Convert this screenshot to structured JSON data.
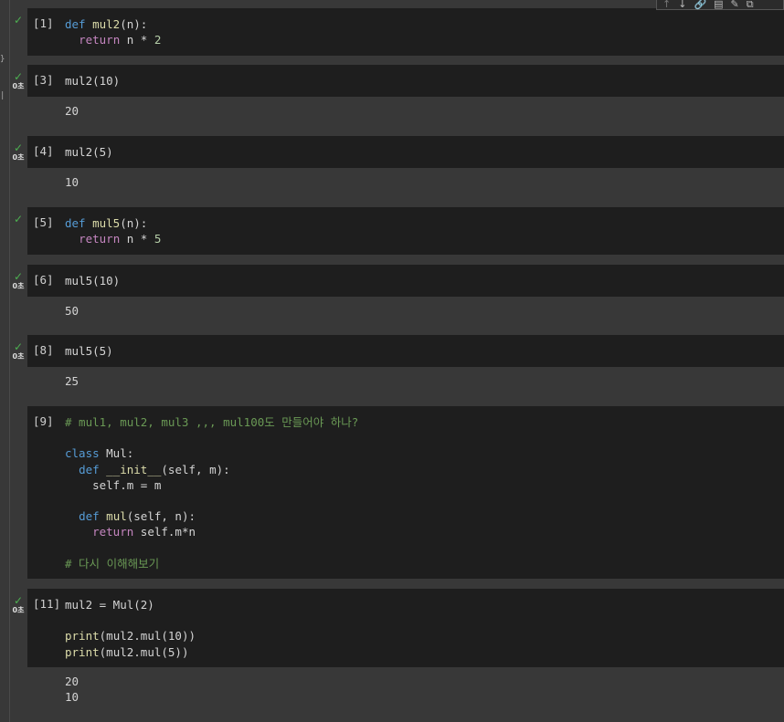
{
  "cells": [
    {
      "prompt": "[1]",
      "status": "done",
      "duration": "",
      "source": [
        [
          [
            "kw2",
            "def "
          ],
          [
            "fn",
            "mul2"
          ],
          [
            "",
            "(n):"
          ]
        ],
        [
          [
            "",
            "  "
          ],
          [
            "kw",
            "return"
          ],
          [
            "",
            " n * "
          ],
          [
            "num",
            "2"
          ]
        ]
      ],
      "output": []
    },
    {
      "prompt": "[3]",
      "status": "done",
      "duration": "0초",
      "source": [
        [
          [
            "",
            "mul2(10)"
          ]
        ]
      ],
      "output": [
        "20"
      ]
    },
    {
      "prompt": "[4]",
      "status": "done",
      "duration": "0초",
      "source": [
        [
          [
            "",
            "mul2(5)"
          ]
        ]
      ],
      "output": [
        "10"
      ]
    },
    {
      "prompt": "[5]",
      "status": "done",
      "duration": "",
      "source": [
        [
          [
            "kw2",
            "def "
          ],
          [
            "fn",
            "mul5"
          ],
          [
            "",
            "(n):"
          ]
        ],
        [
          [
            "",
            "  "
          ],
          [
            "kw",
            "return"
          ],
          [
            "",
            " n * "
          ],
          [
            "num",
            "5"
          ]
        ]
      ],
      "output": []
    },
    {
      "prompt": "[6]",
      "status": "done",
      "duration": "0초",
      "source": [
        [
          [
            "",
            "mul5(10)"
          ]
        ]
      ],
      "output": [
        "50"
      ]
    },
    {
      "prompt": "[8]",
      "status": "done",
      "duration": "0초",
      "source": [
        [
          [
            "",
            "mul5(5)"
          ]
        ]
      ],
      "output": [
        "25"
      ]
    },
    {
      "prompt": "[9]",
      "status": "none",
      "duration": "",
      "source": [
        [
          [
            "cm",
            "# mul1, mul2, mul3 ,,, mul100도 만들어야 하나?"
          ]
        ],
        [
          [
            "",
            ""
          ]
        ],
        [
          [
            "kw2",
            "class "
          ],
          [
            "",
            "Mul:"
          ]
        ],
        [
          [
            "",
            "  "
          ],
          [
            "kw2",
            "def "
          ],
          [
            "fn",
            "__init__"
          ],
          [
            "",
            "(self, m):"
          ]
        ],
        [
          [
            "",
            "    self.m = m"
          ]
        ],
        [
          [
            "",
            ""
          ]
        ],
        [
          [
            "",
            "  "
          ],
          [
            "kw2",
            "def "
          ],
          [
            "fn",
            "mul"
          ],
          [
            "",
            "(self, n):"
          ]
        ],
        [
          [
            "",
            "    "
          ],
          [
            "kw",
            "return"
          ],
          [
            "",
            " self.m*n"
          ]
        ],
        [
          [
            "",
            ""
          ]
        ],
        [
          [
            "cm",
            "# 다시 이해해보기"
          ]
        ]
      ],
      "output": []
    },
    {
      "prompt": "[11]",
      "status": "done",
      "duration": "0초",
      "source": [
        [
          [
            "",
            "mul2 = Mul(2)"
          ]
        ],
        [
          [
            "",
            ""
          ]
        ],
        [
          [
            "fn",
            "print"
          ],
          [
            "",
            "(mul2.mul(10))"
          ]
        ],
        [
          [
            "fn",
            "print"
          ],
          [
            "",
            "(mul2.mul(5))"
          ]
        ]
      ],
      "output": [
        "20",
        "10"
      ]
    }
  ],
  "toolbar": {
    "buttons": [
      {
        "name": "move-up-icon",
        "glyph": "↑"
      },
      {
        "name": "move-down-icon",
        "glyph": "↓"
      },
      {
        "name": "link-icon",
        "glyph": "🔗"
      },
      {
        "name": "comment-icon",
        "glyph": "▤"
      },
      {
        "name": "edit-icon",
        "glyph": "✎"
      },
      {
        "name": "mirror-icon",
        "glyph": "⧉"
      }
    ]
  },
  "status_glyph": "✓"
}
